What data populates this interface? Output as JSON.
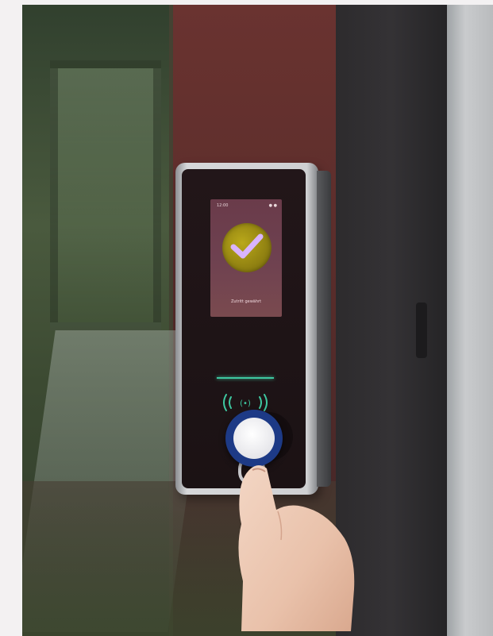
{
  "scene": {
    "subject": "access-control-reader",
    "screen": {
      "time": "12:00",
      "status": "● ●",
      "caption": "Zutritt gewährt",
      "check_color": "#b9a81a",
      "check_mark_color": "#d9b4ff"
    },
    "led_color": "#3ec7a0",
    "fob_color": "#1d3a86"
  }
}
